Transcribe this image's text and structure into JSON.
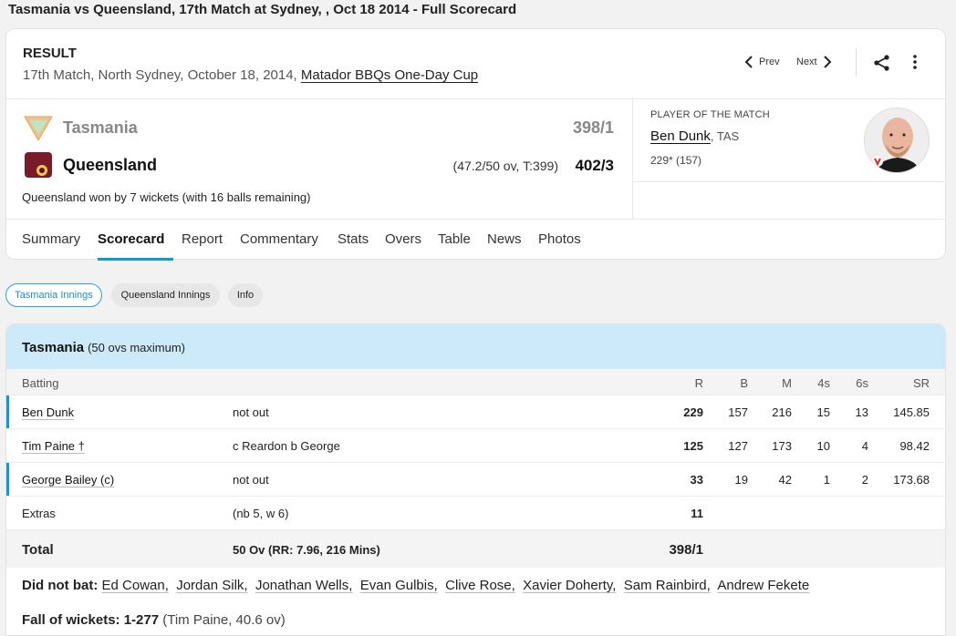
{
  "page_title": "Tasmania vs Queensland, 17th Match at Sydney, , Oct 18 2014 - Full Scorecard",
  "header": {
    "result_label": "RESULT",
    "match_info": "17th Match, North Sydney, October 18, 2014, ",
    "series_link": "Matador BBQs One-Day Cup",
    "prev_label": "Prev",
    "next_label": "Next"
  },
  "teams": [
    {
      "name": "Tasmania",
      "score": "398/1",
      "overs": ""
    },
    {
      "name": "Queensland",
      "score": "402/3",
      "overs": "(47.2/50 ov, T:399)"
    }
  ],
  "status_text": "Queensland won by 7 wickets (with 16 balls remaining)",
  "player_of_match": {
    "label": "PLAYER OF THE MATCH",
    "name": "Ben Dunk",
    "team": ", TAS",
    "stat": "229* (157)"
  },
  "tabs": [
    "Summary",
    "Scorecard",
    "Report",
    "Commentary",
    "Stats",
    "Overs",
    "Table",
    "News",
    "Photos"
  ],
  "active_tab": "Scorecard",
  "innings_pills": [
    "Tasmania Innings",
    "Queensland Innings",
    "Info"
  ],
  "scorecard": {
    "team": "Tasmania",
    "team_sub": "(50 ovs maximum)",
    "headers": {
      "batting": "Batting",
      "r": "R",
      "b": "B",
      "m": "M",
      "fours": "4s",
      "sixes": "6s",
      "sr": "SR"
    },
    "batters": [
      {
        "name": "Ben Dunk",
        "dismissal": "not out",
        "r": "229",
        "b": "157",
        "m": "216",
        "fours": "15",
        "sixes": "13",
        "sr": "145.85"
      },
      {
        "name": "Tim Paine †",
        "dismissal": "c Reardon b George",
        "r": "125",
        "b": "127",
        "m": "173",
        "fours": "10",
        "sixes": "4",
        "sr": "98.42"
      },
      {
        "name": "George Bailey (c)",
        "dismissal": "not out",
        "r": "33",
        "b": "19",
        "m": "42",
        "fours": "1",
        "sixes": "2",
        "sr": "173.68"
      }
    ],
    "extras": {
      "label": "Extras",
      "detail": "(nb 5, w 6)",
      "value": "11"
    },
    "total": {
      "label": "Total",
      "detail": "50 Ov (RR: 7.96, 216 Mins)",
      "value": "398/1"
    },
    "did_not_bat_label": "Did not bat:",
    "did_not_bat": [
      "Ed Cowan,",
      "Jordan Silk,",
      "Jonathan Wells,",
      "Evan Gulbis,",
      "Clive Rose,",
      "Xavier Doherty,",
      "Sam Rainbird,",
      "Andrew Fekete"
    ],
    "fow_label": "Fall of wickets: ",
    "fow_value": "1-277",
    "fow_detail": " (Tim Paine, 40.6 ov)"
  }
}
